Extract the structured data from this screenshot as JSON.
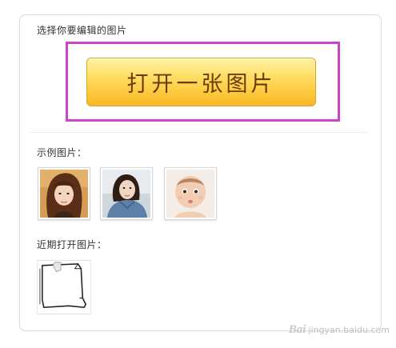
{
  "header": {
    "select_label": "选择你要编辑的图片"
  },
  "open_button": {
    "label": "打开一张图片"
  },
  "examples": {
    "label": "示例图片："
  },
  "recent": {
    "label": "近期打开图片："
  },
  "watermark": {
    "mark": "Bai",
    "text": "jingyan.baidu.com"
  },
  "colors": {
    "highlight": "#cc44cc",
    "button_top": "#fff3a8",
    "button_bottom": "#f6b82a",
    "button_text": "#6a3c0a"
  }
}
